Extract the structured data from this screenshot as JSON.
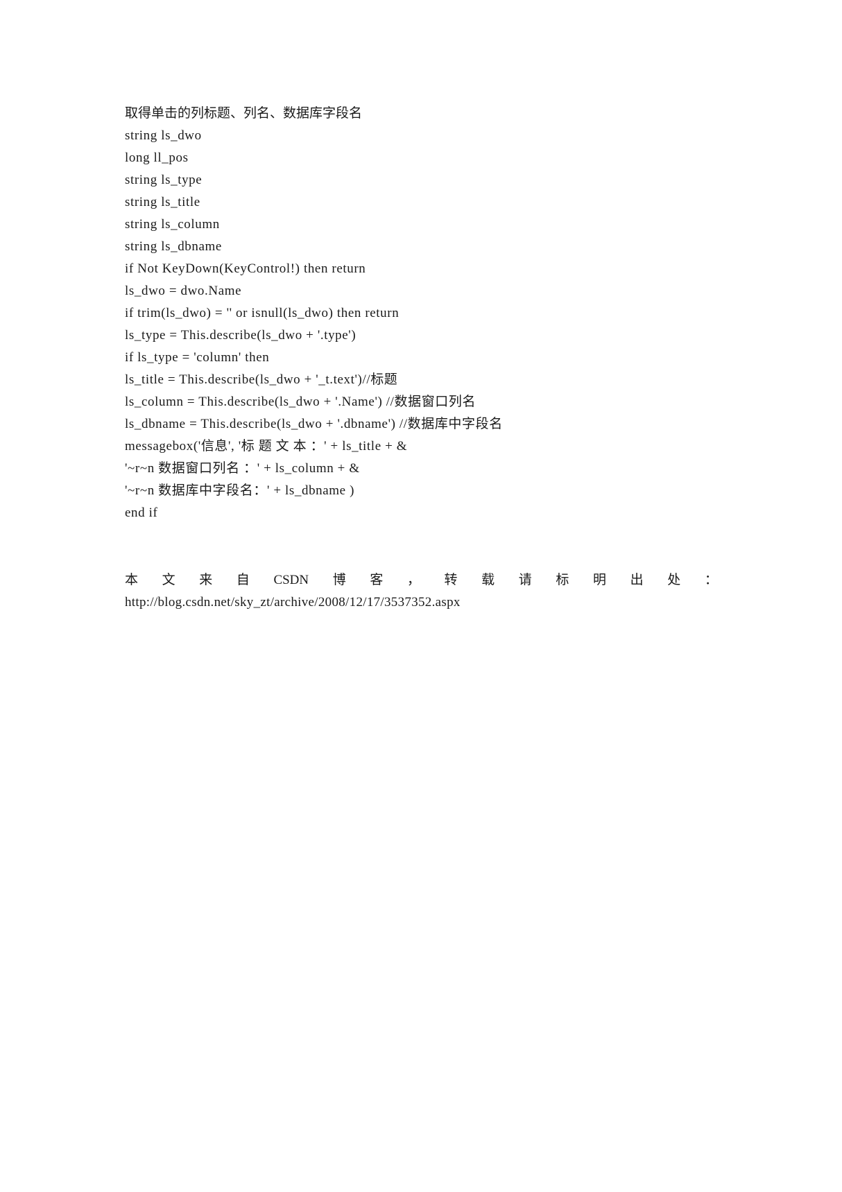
{
  "document": {
    "heading": "取得单击的列标题、列名、数据库字段名",
    "code_lines": [
      "string ls_dwo",
      "long ll_pos",
      "string ls_type",
      "string ls_title",
      "string ls_column",
      "string ls_dbname",
      "if Not KeyDown(KeyControl!) then return",
      "ls_dwo = dwo.Name",
      "if trim(ls_dwo) = '' or isnull(ls_dwo) then return",
      "ls_type = This.describe(ls_dwo + '.type')",
      "if ls_type = 'column' then",
      "ls_title = This.describe(ls_dwo + '_t.text')//标题",
      "ls_column = This.describe(ls_dwo + '.Name') //数据窗口列名",
      "ls_dbname = This.describe(ls_dwo + '.dbname') //数据库中字段名",
      "messagebox('信息', '标 题 文 本 ：' + ls_title + &",
      "'~r~n 数据窗口列名 ：' + ls_column + &",
      "'~r~n 数据库中字段名：' + ls_dbname )",
      "end if"
    ],
    "footer": {
      "source_words": [
        "本",
        "文",
        "来",
        "自",
        "CSDN",
        "博",
        "客",
        "，",
        "转",
        "载",
        "请",
        "标",
        "明",
        "出",
        "处",
        "："
      ],
      "url": "http://blog.csdn.net/sky_zt/archive/2008/12/17/3537352.aspx"
    }
  }
}
